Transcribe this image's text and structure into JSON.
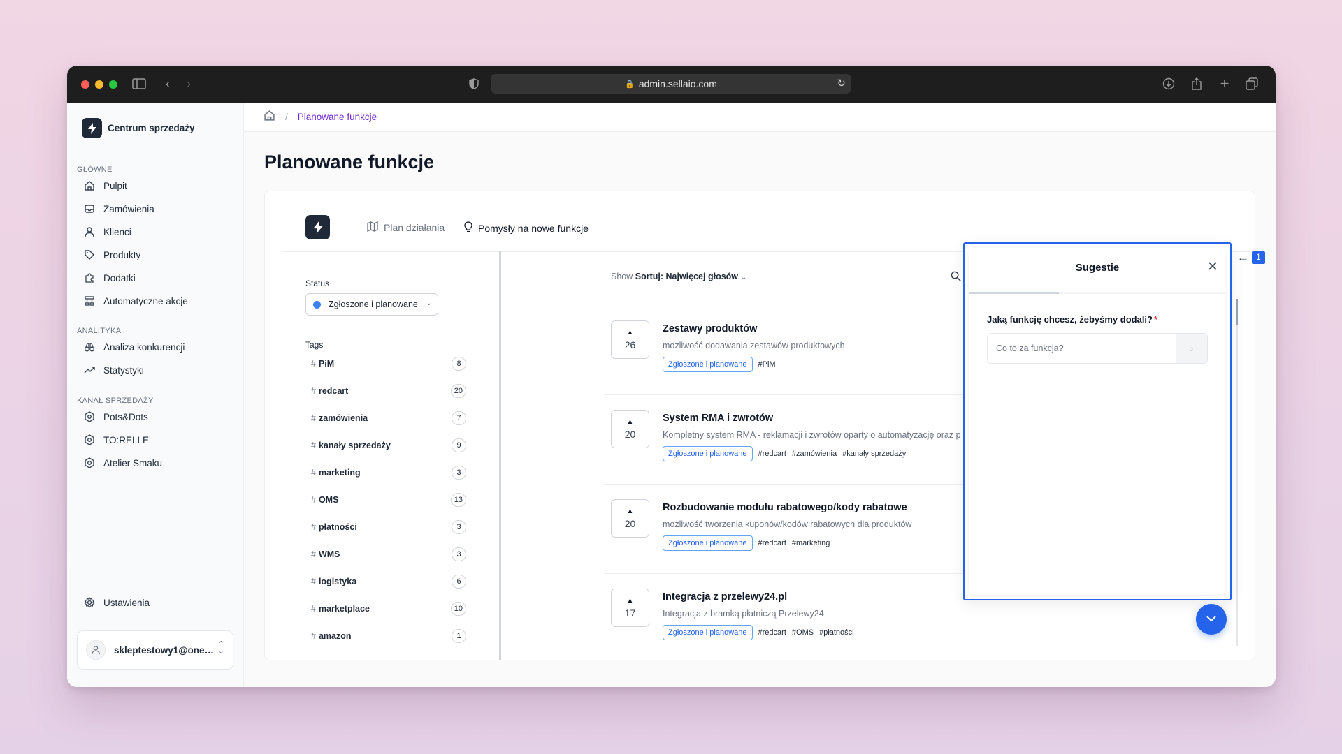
{
  "browser": {
    "url": "admin.sellaio.com"
  },
  "sidebar": {
    "brand": "Centrum sprzedaży",
    "sections": {
      "main": "GŁÓWNE",
      "analytics": "ANALITYKA",
      "channels": "KANAŁ SPRZEDAŻY"
    },
    "main_items": [
      "Pulpit",
      "Zamówienia",
      "Klienci",
      "Produkty",
      "Dodatki",
      "Automatyczne akcje"
    ],
    "analytics_items": [
      "Analiza konkurencji",
      "Statystyki"
    ],
    "channel_items": [
      "Pots&Dots",
      "TO:RELLE",
      "Atelier Smaku"
    ],
    "settings": "Ustawienia",
    "user_email": "skleptestowy1@onet..."
  },
  "breadcrumb": {
    "current": "Planowane funkcje"
  },
  "page_title": "Planowane funkcje",
  "tabs": {
    "roadmap": "Plan działania",
    "ideas": "Pomysły na nowe funkcje"
  },
  "filters": {
    "status_label": "Status",
    "status_value": "Zgłoszone i planowane",
    "tags_label": "Tags",
    "tags": [
      {
        "name": "PiM",
        "count": "8"
      },
      {
        "name": "redcart",
        "count": "20"
      },
      {
        "name": "zamówienia",
        "count": "7"
      },
      {
        "name": "kanały sprzedaży",
        "count": "9"
      },
      {
        "name": "marketing",
        "count": "3"
      },
      {
        "name": "OMS",
        "count": "13"
      },
      {
        "name": "płatności",
        "count": "3"
      },
      {
        "name": "WMS",
        "count": "3"
      },
      {
        "name": "logistyka",
        "count": "6"
      },
      {
        "name": "marketplace",
        "count": "10"
      },
      {
        "name": "amazon",
        "count": "1"
      }
    ]
  },
  "sort": {
    "show": "Show",
    "label": "Sortuj: Najwięcej głosów"
  },
  "features": [
    {
      "votes": "26",
      "title": "Zestawy produktów",
      "desc": "możliwość dodawania zestawów produktowych",
      "status": "Zgłoszone i planowane",
      "tags": [
        "#PiM"
      ]
    },
    {
      "votes": "20",
      "title": "System RMA i zwrotów",
      "desc": "Kompletny system RMA - reklamacji i zwrotów oparty o automatyzację oraz p",
      "status": "Zgłoszone i planowane",
      "tags": [
        "#redcart",
        "#zamówienia",
        "#kanały sprzedaży"
      ]
    },
    {
      "votes": "20",
      "title": "Rozbudowanie modułu rabatowego/kody rabatowe",
      "desc": "możliwość tworzenia kuponów/kodów rabatowych dla produktów",
      "status": "Zgłoszone i planowane",
      "tags": [
        "#redcart",
        "#marketing"
      ]
    },
    {
      "votes": "17",
      "title": "Integracja z przelewy24.pl",
      "desc": "Integracja z bramką płatniczą Przelewy24",
      "status": "Zgłoszone i planowane",
      "tags": [
        "#redcart",
        "#OMS",
        "#płatności"
      ]
    }
  ],
  "panel": {
    "title": "Sugestie",
    "question": "Jaką funkcję chcesz, żebyśmy dodali?",
    "required_mark": "*",
    "placeholder": "Co to za funkcja?",
    "progress_fraction": 0.35
  },
  "annotation": {
    "badge": "1"
  },
  "colors": {
    "accent": "#2563eb",
    "breadcrumb_link": "#6d28d9",
    "status_dot": "#3b82f6"
  }
}
